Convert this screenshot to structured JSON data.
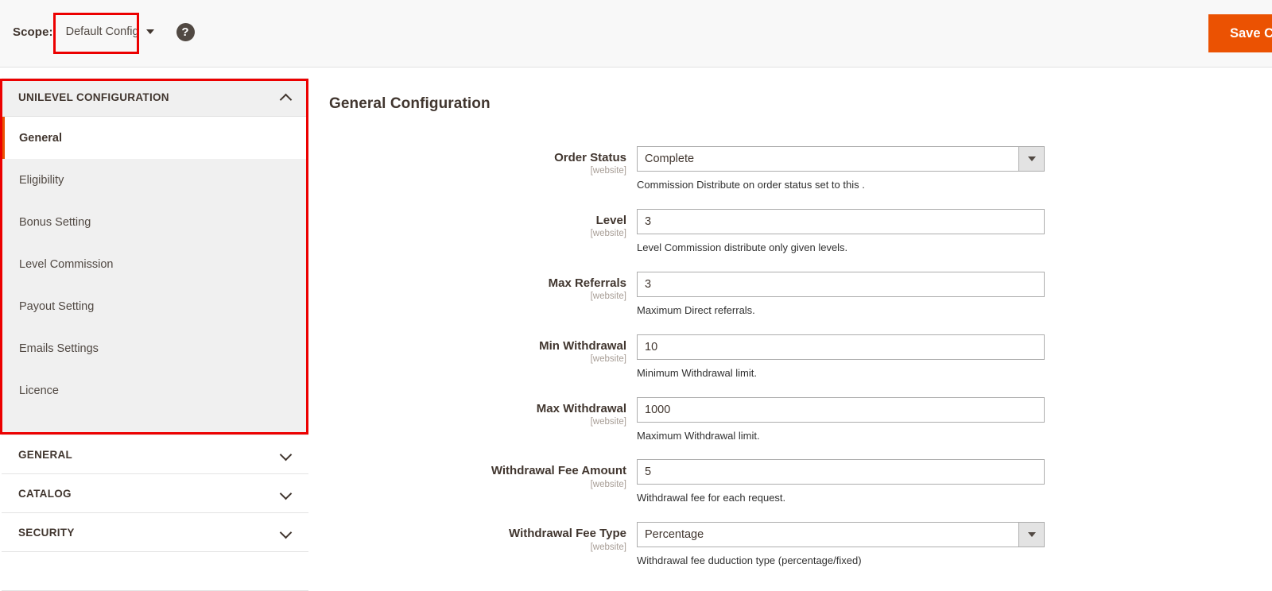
{
  "header": {
    "scope_label": "Scope:",
    "scope_value": "Default Config",
    "help_glyph": "?",
    "save_button": "Save Config",
    "accent_color": "#eb5202",
    "annotation_color": "#ec0000"
  },
  "sidebar": {
    "sections": [
      {
        "title": "UNILEVEL CONFIGURATION",
        "expanded": true,
        "chevron": "chevron-up-icon",
        "items": [
          {
            "label": "General",
            "current": true
          },
          {
            "label": "Eligibility",
            "current": false
          },
          {
            "label": "Bonus Setting",
            "current": false
          },
          {
            "label": "Level Commission",
            "current": false
          },
          {
            "label": "Payout Setting",
            "current": false
          },
          {
            "label": "Emails Settings",
            "current": false
          },
          {
            "label": "Licence",
            "current": false
          }
        ]
      },
      {
        "title": "GENERAL",
        "expanded": false,
        "chevron": "chevron-down-icon",
        "items": []
      },
      {
        "title": "CATALOG",
        "expanded": false,
        "chevron": "chevron-down-icon",
        "items": []
      },
      {
        "title": "SECURITY",
        "expanded": false,
        "chevron": "chevron-down-icon",
        "items": []
      }
    ]
  },
  "main": {
    "title": "General Configuration",
    "scope_tag": "[website]",
    "fields": [
      {
        "label": "Order Status",
        "scope": "[website]",
        "type": "select",
        "value": "Complete",
        "note": "Commission Distribute on order status set to this ."
      },
      {
        "label": "Level",
        "scope": "[website]",
        "type": "text",
        "value": "3",
        "note": "Level Commission distribute only given levels."
      },
      {
        "label": "Max Referrals",
        "scope": "[website]",
        "type": "text",
        "value": "3",
        "note": "Maximum Direct referrals."
      },
      {
        "label": "Min Withdrawal",
        "scope": "[website]",
        "type": "text",
        "value": "10",
        "note": "Minimum Withdrawal limit."
      },
      {
        "label": "Max Withdrawal",
        "scope": "[website]",
        "type": "text",
        "value": "1000",
        "note": "Maximum Withdrawal limit."
      },
      {
        "label": "Withdrawal Fee Amount",
        "scope": "[website]",
        "type": "text",
        "value": "5",
        "note": "Withdrawal fee for each request."
      },
      {
        "label": "Withdrawal Fee Type",
        "scope": "[website]",
        "type": "select",
        "value": "Percentage",
        "note": "Withdrawal fee duduction type (percentage/fixed)"
      }
    ]
  }
}
